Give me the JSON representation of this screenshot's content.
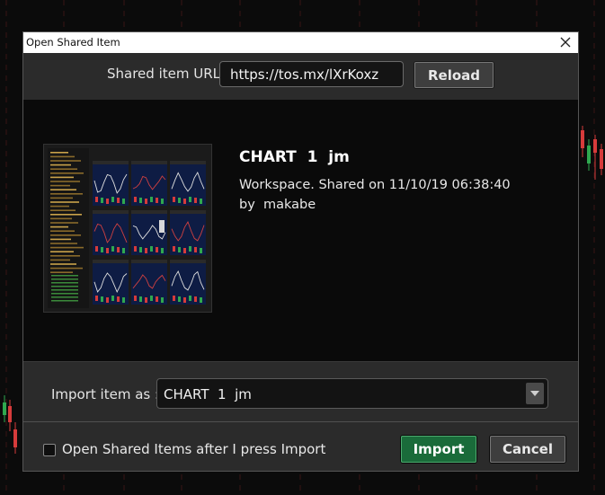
{
  "dialog": {
    "title": "Open Shared Item",
    "close_icon": "close-icon"
  },
  "url_row": {
    "label": "Shared item URL:",
    "url_value": "https://tos.mx/lXrKoxz",
    "reload_label": "Reload"
  },
  "preview": {
    "thumbnail_icon": "workspace-thumbnail",
    "item_name": "CHART  1  jm",
    "description": "Workspace. Shared on 11/10/19 06:38:40",
    "author_line": "by  makabe"
  },
  "import_row": {
    "label": "Import item as :",
    "selected_value": "CHART  1  jm",
    "dropdown_icon": "chevron-down-icon"
  },
  "bottom_row": {
    "checkbox_label": "Open Shared Items after I press Import",
    "checkbox_checked": false,
    "import_label": "Import",
    "cancel_label": "Cancel"
  },
  "colors": {
    "dialog_bg": "#2b2b2b",
    "preview_bg": "#0a0a0a",
    "import_button": "#1a6b3a",
    "title_bar": "#ffffff"
  }
}
